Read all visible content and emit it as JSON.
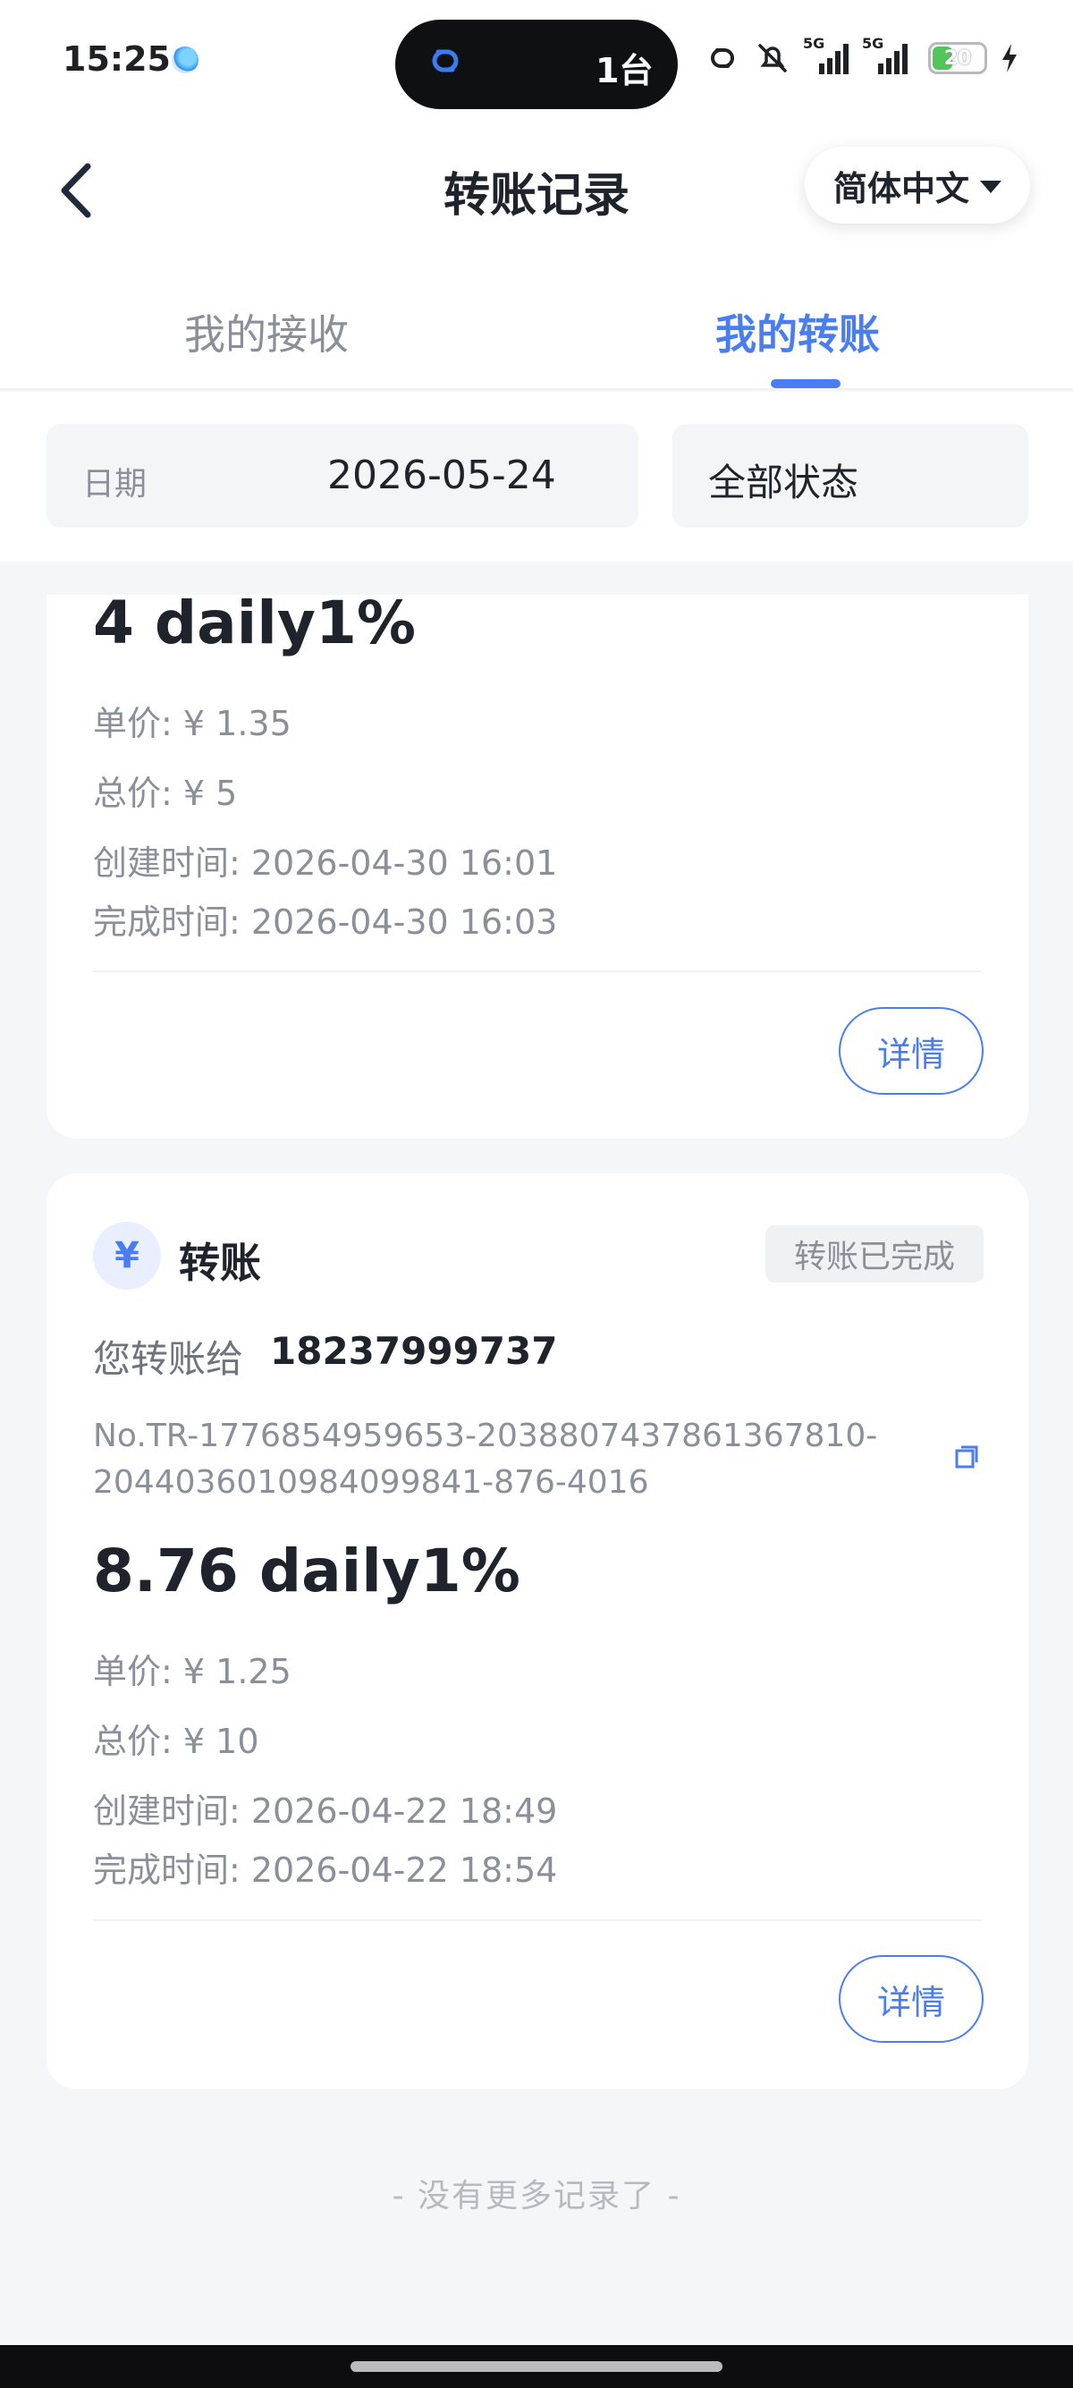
{
  "status_bar": {
    "time": "15:25",
    "island_text": "1台",
    "battery": "20",
    "net_1": "5G",
    "net_2": "5G",
    "icons": [
      "link-icon",
      "bell-off-icon",
      "signal-icon",
      "signal-icon",
      "battery-icon",
      "charging-icon"
    ]
  },
  "header": {
    "title": "转账记录",
    "language": "简体中文"
  },
  "tabs": [
    {
      "label": "我的接收",
      "active": false
    },
    {
      "label": "我的转账",
      "active": true
    }
  ],
  "filters": {
    "date_label": "日期",
    "date_value": "2026-05-24",
    "status_value": "全部状态"
  },
  "records": [
    {
      "amount": "4 daily1%",
      "unit_price": "单价: ¥ 1.35",
      "total_price": "总价: ¥ 5",
      "created": "创建时间: 2026-04-30 16:01",
      "completed": "完成时间: 2026-04-30 16:03",
      "detail_label": "详情"
    },
    {
      "type_icon": "¥",
      "type": "转账",
      "status": "转账已完成",
      "to_label": "您转账给",
      "to_account": "18237999737",
      "order_no": "No.TR-1776854959653-2038807437861367810-2044036010984099841-876-4016",
      "amount": "8.76 daily1%",
      "unit_price": "单价: ¥ 1.25",
      "total_price": "总价: ¥ 10",
      "created": "创建时间: 2026-04-22 18:49",
      "completed": "完成时间: 2026-04-22 18:54",
      "detail_label": "详情"
    }
  ],
  "footer": {
    "no_more": "- 没有更多记录了 -"
  },
  "colors": {
    "accent": "#4a7ef0",
    "background": "#f5f6f8",
    "muted_text": "#8a8f99"
  }
}
